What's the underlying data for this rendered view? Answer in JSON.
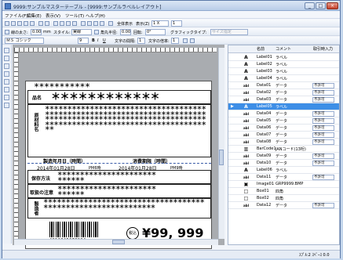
{
  "window": {
    "title": "9999:サンプルマスターテーブル - [9999:サンプルラベルレイアウト]",
    "min": "_",
    "max": "□",
    "close": "×"
  },
  "menu": [
    "ファイル(F)",
    "編集(E)",
    "表示(V)",
    "ツール(T)",
    "ヘルプ(H)"
  ],
  "toolbar1": {
    "view_all": "全体表示",
    "zoom_label": "表示(Z)",
    "zoom_value": "1 X",
    "zoom2_value": "1"
  },
  "toolbar2": {
    "frame_width_label": "線の太さ:",
    "frame_width_value": "0.00",
    "unit": "mm",
    "style_label": "スタイル:",
    "style_value": "実線",
    "angle_label": "角丸半径:",
    "angle_value": "0.00",
    "rotation_label": "回転:",
    "rotation_value": "0°",
    "graphic_type_label": "グラフィックタイプ:",
    "graphic_type_value": "サイズ指定"
  },
  "toolbar3": {
    "font_value": "ＭＳ ゴシック",
    "size_value": "9",
    "bold": "B",
    "italic": "I",
    "underline": "U",
    "char_spacing_label": "文字の間隔:",
    "char_spacing_value": "1",
    "char_rate_label": "文字の倍率:",
    "char_rate_value": "1"
  },
  "label": {
    "top_line": "＊＊＊＊＊＊＊＊＊＊＊",
    "item_title": "品名",
    "ingredients_title": "原材料名",
    "mfg_date_header": "製造年月日（時間）",
    "exp_date_header": "消費期限（時間）",
    "mfg_date_value": "2014年01月28日",
    "mfg_time": "PM6時",
    "exp_date_value": "2014年01月28日",
    "exp_time": "PM9時",
    "storage_title": "保存方法",
    "handling_title": "取扱の注意",
    "maker_title": "製造者",
    "barcode_digits": "4912345678904",
    "price_tag": "税込",
    "price": "¥99, 999"
  },
  "panel": {
    "headers": [
      "",
      "",
      "名前",
      "コメント",
      "取引時入力"
    ],
    "rows": [
      {
        "icon": "A",
        "name": "Label01",
        "comment": "ラベル",
        "input": ""
      },
      {
        "icon": "A",
        "name": "Label02",
        "comment": "ラベル",
        "input": ""
      },
      {
        "icon": "A",
        "name": "Label03",
        "comment": "ラベル",
        "input": ""
      },
      {
        "icon": "A",
        "name": "Label04",
        "comment": "ラベル",
        "input": ""
      },
      {
        "icon": "abl",
        "name": "Data01",
        "comment": "データ",
        "input": "不許可"
      },
      {
        "icon": "abl",
        "name": "Data02",
        "comment": "データ",
        "input": "不許可"
      },
      {
        "icon": "abl",
        "name": "Data03",
        "comment": "データ",
        "input": "不許可"
      },
      {
        "icon": "A",
        "name": "Label05",
        "comment": "ラベル",
        "input": ""
      },
      {
        "icon": "abl",
        "name": "Data04",
        "comment": "データ",
        "input": "不許可"
      },
      {
        "icon": "abl",
        "name": "Data05",
        "comment": "データ",
        "input": "不許可"
      },
      {
        "icon": "abl",
        "name": "Data06",
        "comment": "データ",
        "input": "不許可"
      },
      {
        "icon": "abl",
        "name": "Data07",
        "comment": "データ",
        "input": "不許可"
      },
      {
        "icon": "abl",
        "name": "Data08",
        "comment": "データ",
        "input": "不許可"
      },
      {
        "icon": "▥",
        "name": "BarCode1",
        "comment": "JANコード(13桁)",
        "input": ""
      },
      {
        "icon": "abl",
        "name": "Data09",
        "comment": "データ",
        "input": "不許可"
      },
      {
        "icon": "abl",
        "name": "Data10",
        "comment": "データ",
        "input": "不許可"
      },
      {
        "icon": "A",
        "name": "Label06",
        "comment": "ラベル",
        "input": ""
      },
      {
        "icon": "abl",
        "name": "Data11",
        "comment": "データ",
        "input": "不許可"
      },
      {
        "icon": "▣",
        "name": "Image01",
        "comment": "GRP9999.BMP",
        "input": ""
      },
      {
        "icon": "□",
        "name": "Box01",
        "comment": "四角",
        "input": ""
      },
      {
        "icon": "□",
        "name": "Box02",
        "comment": "四角",
        "input": ""
      },
      {
        "icon": "abl",
        "name": "Data12",
        "comment": "データ",
        "input": "不許可"
      }
    ],
    "selected_index": 7
  },
  "status": {
    "position": "ｽﾌﾟﾙ:2  ｽﾍﾟｰｽ 0.0"
  },
  "colors": {
    "selection": "#3d8ee6",
    "titlebar": "#c9d9ee"
  }
}
